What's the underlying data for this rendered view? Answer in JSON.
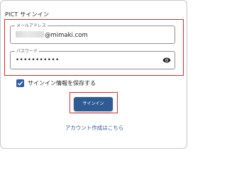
{
  "dialog": {
    "title": "PICT サインイン",
    "email_field": {
      "label": "メールアドレス",
      "value_suffix": "@mimaki.com"
    },
    "password_field": {
      "label": "パスワード",
      "value": "•••••••••••"
    },
    "save_checkbox": {
      "label": "サインイン情報を保存する",
      "checked": true
    },
    "signin_button": "サインイン",
    "create_account_link": "アカウント作成はこちら"
  },
  "colors": {
    "accent": "#2e5b94",
    "highlight": "#d62c2c"
  }
}
